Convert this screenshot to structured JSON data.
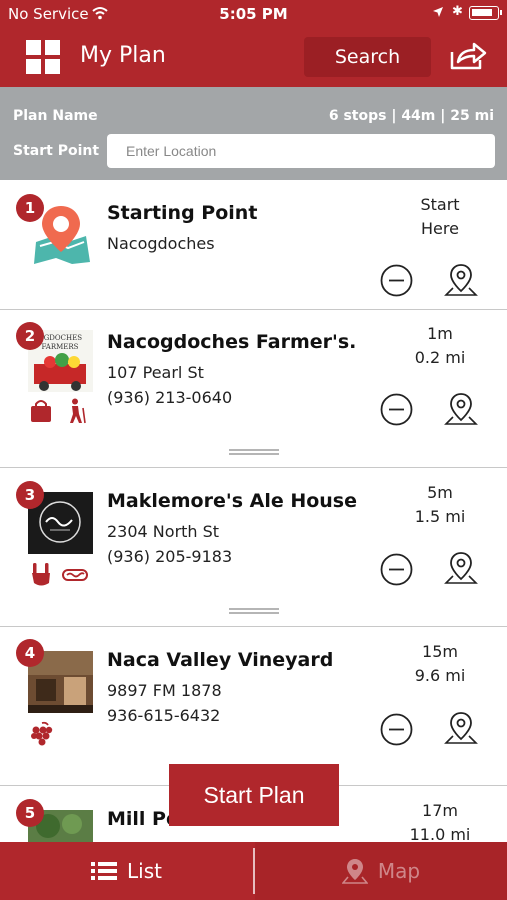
{
  "status_bar": {
    "carrier": "No Service",
    "time": "5:05 PM",
    "battery_level": 0.85
  },
  "header": {
    "title": "My Plan",
    "search_label": "Search",
    "menu_icon": "grid-icon",
    "share_icon": "share-icon"
  },
  "plan": {
    "name_label": "Plan Name",
    "stats": "6 stops | 44m | 25 mi",
    "start_label": "Start Point",
    "start_placeholder": "Enter Location"
  },
  "stops": [
    {
      "number": "1",
      "name": "Starting Point",
      "line1": "Nacogdoches",
      "line2": "",
      "eta1": "Start",
      "eta2": "Here"
    },
    {
      "number": "2",
      "name": "Nacogdoches Farmer's...",
      "line1": "107 Pearl St",
      "line2": "(936) 213-0640",
      "eta1": "1m",
      "eta2": "0.2 mi"
    },
    {
      "number": "3",
      "name": "Maklemore's Ale House...",
      "line1": "2304 North St",
      "line2": "(936) 205-9183",
      "eta1": "5m",
      "eta2": "1.5 mi"
    },
    {
      "number": "4",
      "name": "Naca Valley Vineyard",
      "line1": "9897 FM 1878",
      "line2": "936-615-6432",
      "eta1": "15m",
      "eta2": "9.6 mi"
    },
    {
      "number": "5",
      "name": "Mill Po",
      "line1": "",
      "line2": "",
      "eta1": "17m",
      "eta2": "11.0 mi"
    }
  ],
  "start_plan_label": "Start Plan",
  "tabs": {
    "list": "List",
    "map": "Map"
  },
  "colors": {
    "brand_red": "#b0272c",
    "plan_bar_gray": "#a3a6a8"
  }
}
